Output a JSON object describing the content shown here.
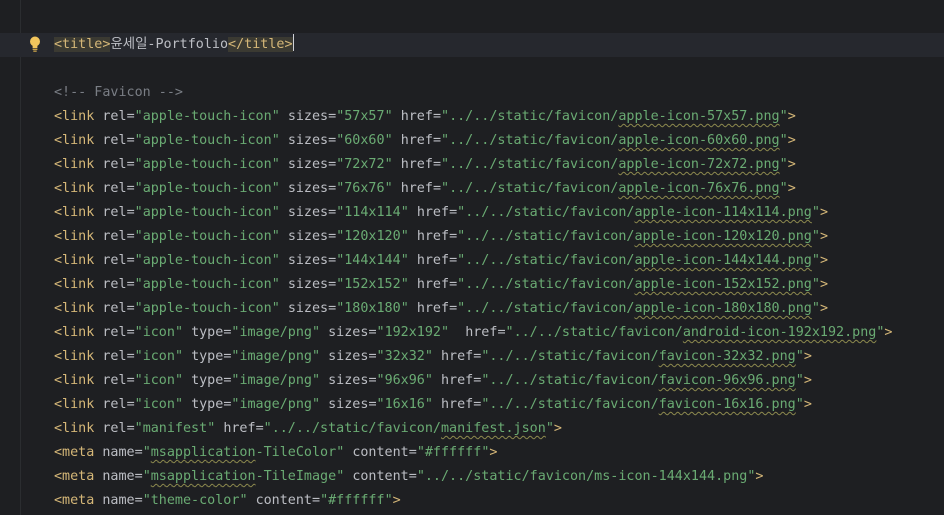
{
  "title_line": {
    "open_tag": "<title>",
    "text": "윤세일-Portfolio",
    "close_tag": "</title>"
  },
  "comment": "<!-- Favicon -->",
  "syntax_colors": {
    "tag": "#d5b778",
    "string": "#6aab73",
    "comment": "#7a7e85",
    "text": "#bcbec4",
    "background": "#1e1f22"
  },
  "code_lines": [
    {
      "tag": "link",
      "attrs": [
        [
          "rel",
          "apple-touch-icon"
        ],
        [
          "sizes",
          "57x57"
        ],
        [
          "href",
          "../../static/favicon/",
          "apple-icon-57x57.png"
        ]
      ]
    },
    {
      "tag": "link",
      "attrs": [
        [
          "rel",
          "apple-touch-icon"
        ],
        [
          "sizes",
          "60x60"
        ],
        [
          "href",
          "../../static/favicon/",
          "apple-icon-60x60.png"
        ]
      ]
    },
    {
      "tag": "link",
      "attrs": [
        [
          "rel",
          "apple-touch-icon"
        ],
        [
          "sizes",
          "72x72"
        ],
        [
          "href",
          "../../static/favicon/",
          "apple-icon-72x72.png"
        ]
      ]
    },
    {
      "tag": "link",
      "attrs": [
        [
          "rel",
          "apple-touch-icon"
        ],
        [
          "sizes",
          "76x76"
        ],
        [
          "href",
          "../../static/favicon/",
          "apple-icon-76x76.png"
        ]
      ]
    },
    {
      "tag": "link",
      "attrs": [
        [
          "rel",
          "apple-touch-icon"
        ],
        [
          "sizes",
          "114x114"
        ],
        [
          "href",
          "../../static/favicon/",
          "apple-icon-114x114.png"
        ]
      ]
    },
    {
      "tag": "link",
      "attrs": [
        [
          "rel",
          "apple-touch-icon"
        ],
        [
          "sizes",
          "120x120"
        ],
        [
          "href",
          "../../static/favicon/",
          "apple-icon-120x120.png"
        ]
      ]
    },
    {
      "tag": "link",
      "attrs": [
        [
          "rel",
          "apple-touch-icon"
        ],
        [
          "sizes",
          "144x144"
        ],
        [
          "href",
          "../../static/favicon/",
          "apple-icon-144x144.png"
        ]
      ]
    },
    {
      "tag": "link",
      "attrs": [
        [
          "rel",
          "apple-touch-icon"
        ],
        [
          "sizes",
          "152x152"
        ],
        [
          "href",
          "../../static/favicon/",
          "apple-icon-152x152.png"
        ]
      ]
    },
    {
      "tag": "link",
      "attrs": [
        [
          "rel",
          "apple-touch-icon"
        ],
        [
          "sizes",
          "180x180"
        ],
        [
          "href",
          "../../static/favicon/",
          "apple-icon-180x180.png"
        ]
      ]
    },
    {
      "tag": "link",
      "attrs": [
        [
          "rel",
          "icon"
        ],
        [
          "type",
          "image/png"
        ],
        [
          "sizes",
          "192x192"
        ],
        [
          "href",
          "../../static/favicon/",
          "android-icon-192x192.png"
        ]
      ],
      "extra_space_before": [
        "href"
      ]
    },
    {
      "tag": "link",
      "attrs": [
        [
          "rel",
          "icon"
        ],
        [
          "type",
          "image/png"
        ],
        [
          "sizes",
          "32x32"
        ],
        [
          "href",
          "../../static/favicon/",
          "favicon-32x32.png"
        ]
      ]
    },
    {
      "tag": "link",
      "attrs": [
        [
          "rel",
          "icon"
        ],
        [
          "type",
          "image/png"
        ],
        [
          "sizes",
          "96x96"
        ],
        [
          "href",
          "../../static/favicon/",
          "favicon-96x96.png"
        ]
      ]
    },
    {
      "tag": "link",
      "attrs": [
        [
          "rel",
          "icon"
        ],
        [
          "type",
          "image/png"
        ],
        [
          "sizes",
          "16x16"
        ],
        [
          "href",
          "../../static/favicon/",
          "favicon-16x16.png"
        ]
      ]
    },
    {
      "tag": "link",
      "attrs": [
        [
          "rel",
          "manifest"
        ],
        [
          "href",
          "../../static/favicon/",
          "manifest.json"
        ]
      ]
    },
    {
      "tag": "meta",
      "attrs": [
        [
          "name",
          "",
          "msapplication",
          "-TileColor"
        ],
        [
          "content",
          "#ffffff"
        ]
      ]
    },
    {
      "tag": "meta",
      "attrs": [
        [
          "name",
          "",
          "msapplication",
          "-TileImage"
        ],
        [
          "content",
          "../../static/favicon/ms-icon-144x144.png"
        ]
      ]
    },
    {
      "tag": "meta",
      "attrs": [
        [
          "name",
          "theme-color"
        ],
        [
          "content",
          "#ffffff"
        ]
      ]
    }
  ]
}
